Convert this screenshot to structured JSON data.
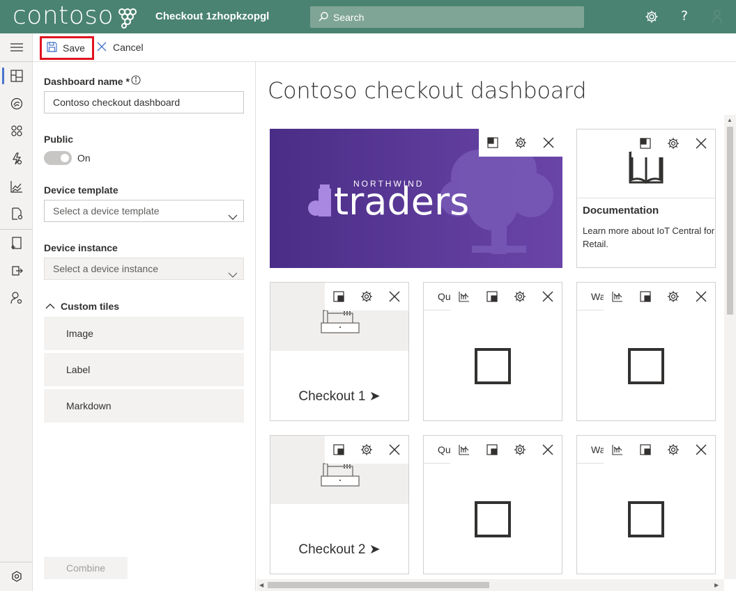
{
  "header": {
    "logo_text": "contoso",
    "app_title": "Checkout 1zhopkzopgl",
    "search_placeholder": "Search",
    "brand_color": "#4a8371",
    "icons": [
      "settings-icon",
      "help-icon",
      "account-icon"
    ],
    "help_glyph": "?"
  },
  "rail": {
    "items": [
      "menu-icon",
      "dashboard-icon",
      "devices-icon",
      "device-groups-icon",
      "rules-icon",
      "analytics-icon",
      "jobs-icon",
      "device-templates-icon",
      "data-export-icon",
      "administration-icon",
      "settings-icon"
    ]
  },
  "toolbar": {
    "save_label": "Save",
    "cancel_label": "Cancel"
  },
  "settings": {
    "dashboard_name_label": "Dashboard name *",
    "dashboard_name_value": "Contoso checkout dashboard",
    "public_label": "Public",
    "public_state": "On",
    "device_template_label": "Device template",
    "device_template_placeholder": "Select a device template",
    "device_instance_label": "Device instance",
    "device_instance_placeholder": "Select a device instance",
    "custom_tiles_label": "Custom tiles",
    "custom_tiles": [
      "Image",
      "Label",
      "Markdown"
    ],
    "combine_label": "Combine"
  },
  "dashboard": {
    "title": "Contoso checkout dashboard",
    "image_tile": {
      "brand_small": "NORTHWIND",
      "brand_large": "traders",
      "bg_color": "#5b3a96"
    },
    "doc_tile": {
      "title": "Documentation",
      "description": "Learn more about IoT Central for Retail."
    },
    "checkout_tiles": [
      "Checkout 1 ➤",
      "Checkout 2 ➤"
    ],
    "chart_tiles": [
      {
        "name": "Queue"
      },
      {
        "name": "Wait"
      },
      {
        "name": "Queue"
      },
      {
        "name": "Wait"
      }
    ]
  }
}
